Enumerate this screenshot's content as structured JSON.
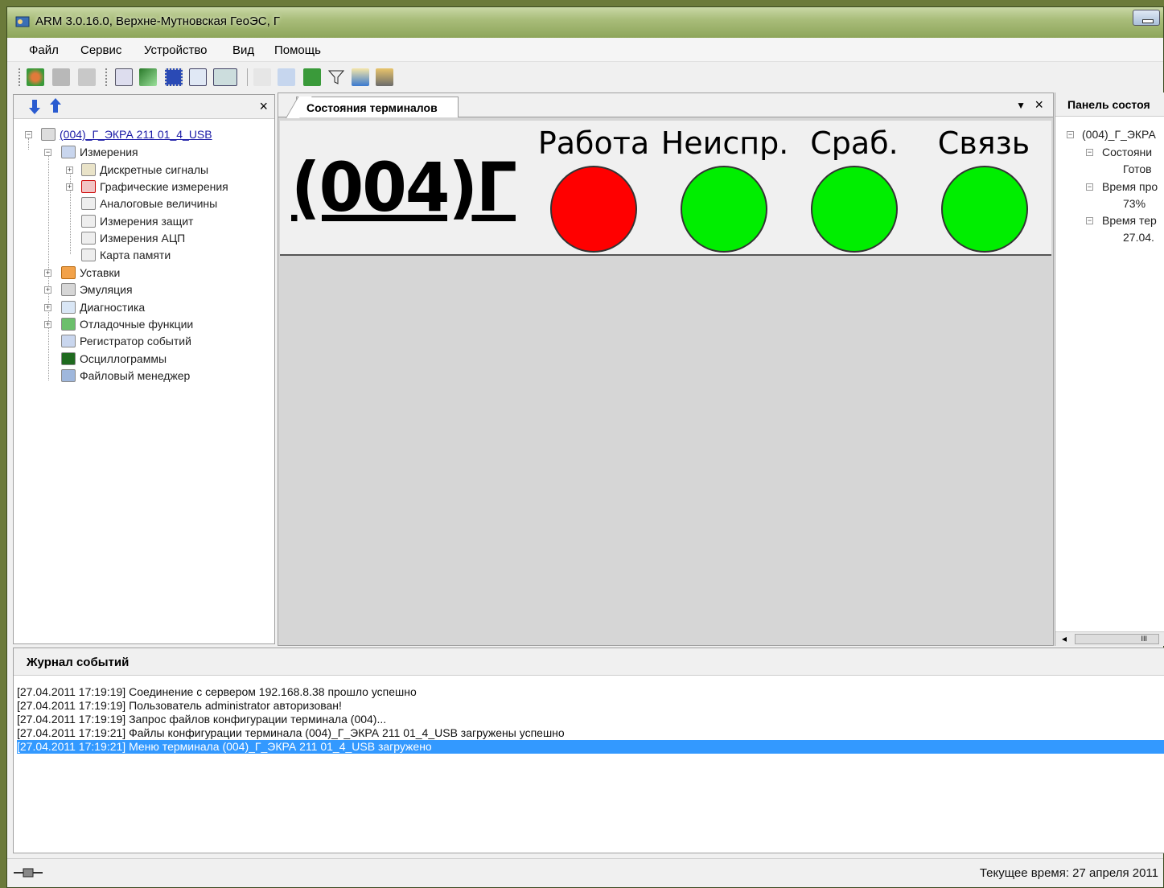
{
  "window": {
    "title": "ARM 3.0.16.0, Верхне-Мутновская ГеоЭС, Г"
  },
  "menu": [
    "Файл",
    "Сервис",
    "Устройство",
    "Вид",
    "Помощь"
  ],
  "tree": {
    "root": "(004)_Г_ЭКРА 211 01_4_USB",
    "items": [
      {
        "label": "Измерения"
      },
      {
        "label": "Дискретные сигналы"
      },
      {
        "label": "Графические измерения"
      },
      {
        "label": "Аналоговые величины"
      },
      {
        "label": "Измерения защит"
      },
      {
        "label": "Измерения АЦП"
      },
      {
        "label": "Карта памяти"
      },
      {
        "label": "Уставки"
      },
      {
        "label": "Эмуляция"
      },
      {
        "label": "Диагностика"
      },
      {
        "label": "Отладочные функции"
      },
      {
        "label": "Регистратор событий"
      },
      {
        "label": "Осциллограммы"
      },
      {
        "label": "Файловый менеджер"
      }
    ],
    "close": "×"
  },
  "document": {
    "tab": "Состояния терминалов",
    "dropdown": "▼",
    "close": "×",
    "terminal_name": "(004)Г",
    "indicators": [
      {
        "label": "Работа",
        "color": "#ff0000"
      },
      {
        "label": "Неиспр.",
        "color": "#00ee00"
      },
      {
        "label": "Сраб.",
        "color": "#00ee00"
      },
      {
        "label": "Связь",
        "color": "#00ee00"
      }
    ]
  },
  "right_panel": {
    "title": "Панель состоя",
    "lines": [
      "(004)_Г_ЭКРА",
      "Состояни",
      "Готов",
      "Время про",
      "73%",
      "Время тер",
      "27.04."
    ],
    "scroll_arrow": "◂",
    "scroll_thumb": "III"
  },
  "log": {
    "title": "Журнал событий",
    "lines": [
      "[27.04.2011 17:19:19] Соединение с сервером 192.168.8.38 прошло успешно",
      "[27.04.2011 17:19:19] Пользователь administrator авторизован!",
      "[27.04.2011 17:19:19] Запрос файлов конфигурации терминала (004)...",
      "[27.04.2011 17:19:21] Файлы конфигурации терминала (004)_Г_ЭКРА 211 01_4_USB загружены успешно",
      "[27.04.2011 17:19:21] Меню терминала (004)_Г_ЭКРА 211 01_4_USB загружено"
    ]
  },
  "statusbar": {
    "clock": "Текущее время: 27 апреля 2011"
  }
}
